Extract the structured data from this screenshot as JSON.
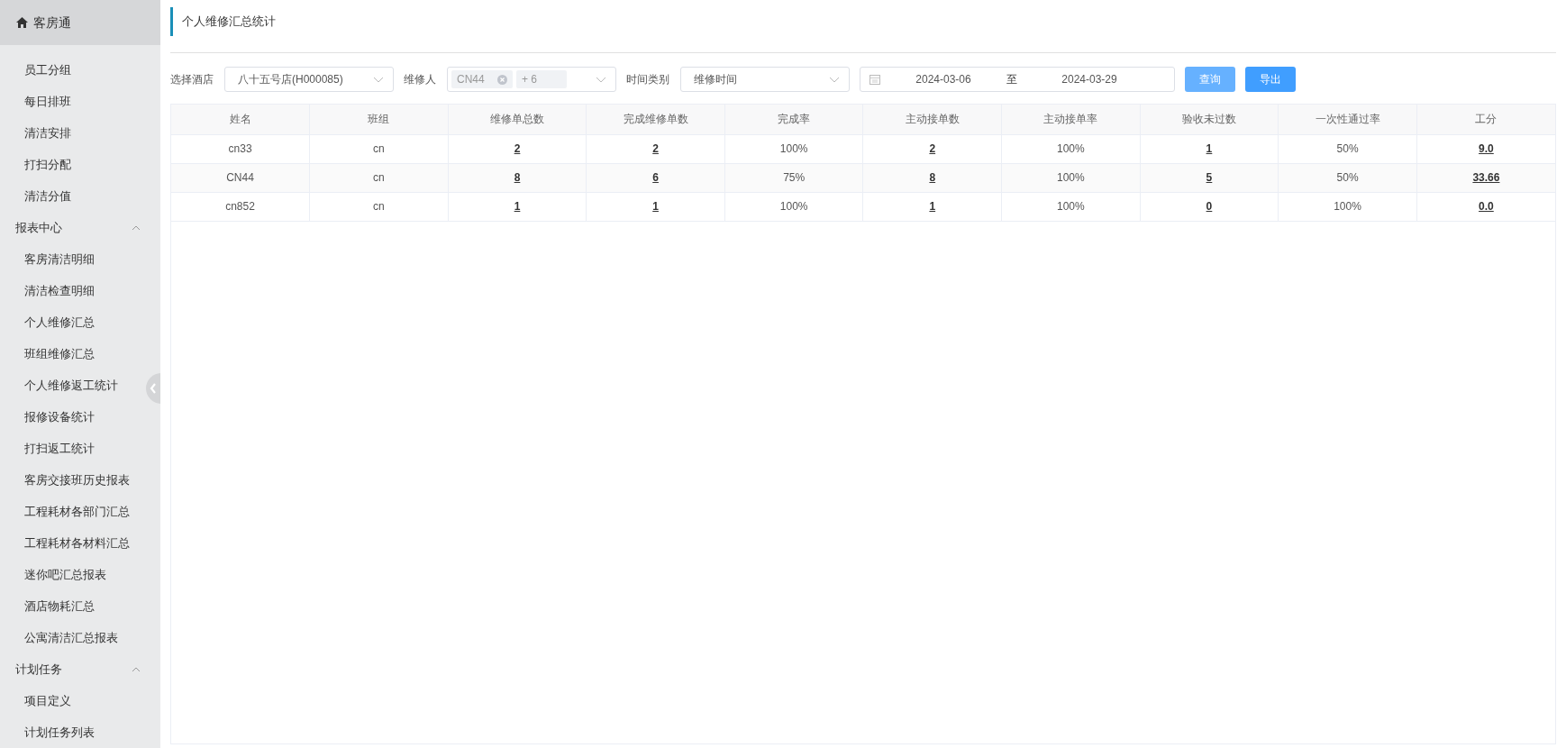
{
  "sidebar": {
    "brand": "客房通",
    "items": [
      {
        "kind": "item",
        "label": "员工分组"
      },
      {
        "kind": "item",
        "label": "每日排班"
      },
      {
        "kind": "item",
        "label": "清洁安排"
      },
      {
        "kind": "item",
        "label": "打扫分配"
      },
      {
        "kind": "item",
        "label": "清洁分值"
      },
      {
        "kind": "group",
        "label": "报表中心",
        "expanded": true,
        "children": [
          {
            "label": "客房清洁明细"
          },
          {
            "label": "清洁检查明细"
          },
          {
            "label": "个人维修汇总"
          },
          {
            "label": "班组维修汇总"
          },
          {
            "label": "个人维修返工统计"
          },
          {
            "label": "报修设备统计"
          },
          {
            "label": "打扫返工统计"
          },
          {
            "label": "客房交接班历史报表"
          },
          {
            "label": "工程耗材各部门汇总"
          },
          {
            "label": "工程耗材各材料汇总"
          },
          {
            "label": "迷你吧汇总报表"
          },
          {
            "label": "酒店物耗汇总"
          },
          {
            "label": "公寓清洁汇总报表"
          }
        ]
      },
      {
        "kind": "group",
        "label": "计划任务",
        "expanded": true,
        "children": [
          {
            "label": "项目定义"
          },
          {
            "label": "计划任务列表"
          }
        ]
      }
    ]
  },
  "page_title": "个人维修汇总统计",
  "filters": {
    "hotel": {
      "label": "选择酒店",
      "value": "八十五号店(H000085)"
    },
    "repairer": {
      "label": "维修人",
      "tags": [
        "CN44",
        "+ 6"
      ]
    },
    "time_type": {
      "label": "时间类别",
      "value": "维修时间"
    },
    "date_range": {
      "start": "2024-03-06",
      "separator": "至",
      "end": "2024-03-29"
    },
    "buttons": [
      {
        "label": "查询",
        "disabled": true
      },
      {
        "label": "导出",
        "disabled": false
      }
    ]
  },
  "table": {
    "columns": [
      "姓名",
      "班组",
      "维修单总数",
      "完成维修单数",
      "完成率",
      "主动接单数",
      "主动接单率",
      "验收未过数",
      "一次性通过率",
      "工分"
    ],
    "rows": [
      [
        {
          "text": "cn33",
          "link": false
        },
        {
          "text": "cn",
          "link": false
        },
        {
          "text": "2",
          "link": true
        },
        {
          "text": "2",
          "link": true
        },
        {
          "text": "100%",
          "link": false
        },
        {
          "text": "2",
          "link": true
        },
        {
          "text": "100%",
          "link": false
        },
        {
          "text": "1",
          "link": true
        },
        {
          "text": "50%",
          "link": false
        },
        {
          "text": "9.0",
          "link": true
        }
      ],
      [
        {
          "text": "CN44",
          "link": false
        },
        {
          "text": "cn",
          "link": false
        },
        {
          "text": "8",
          "link": true
        },
        {
          "text": "6",
          "link": true
        },
        {
          "text": "75%",
          "link": false
        },
        {
          "text": "8",
          "link": true
        },
        {
          "text": "100%",
          "link": false
        },
        {
          "text": "5",
          "link": true
        },
        {
          "text": "50%",
          "link": false
        },
        {
          "text": "33.66",
          "link": true
        }
      ],
      [
        {
          "text": "cn852",
          "link": false
        },
        {
          "text": "cn",
          "link": false
        },
        {
          "text": "1",
          "link": true
        },
        {
          "text": "1",
          "link": true
        },
        {
          "text": "100%",
          "link": false
        },
        {
          "text": "1",
          "link": true
        },
        {
          "text": "100%",
          "link": false
        },
        {
          "text": "0",
          "link": true
        },
        {
          "text": "100%",
          "link": false
        },
        {
          "text": "0.0",
          "link": true
        }
      ]
    ]
  }
}
